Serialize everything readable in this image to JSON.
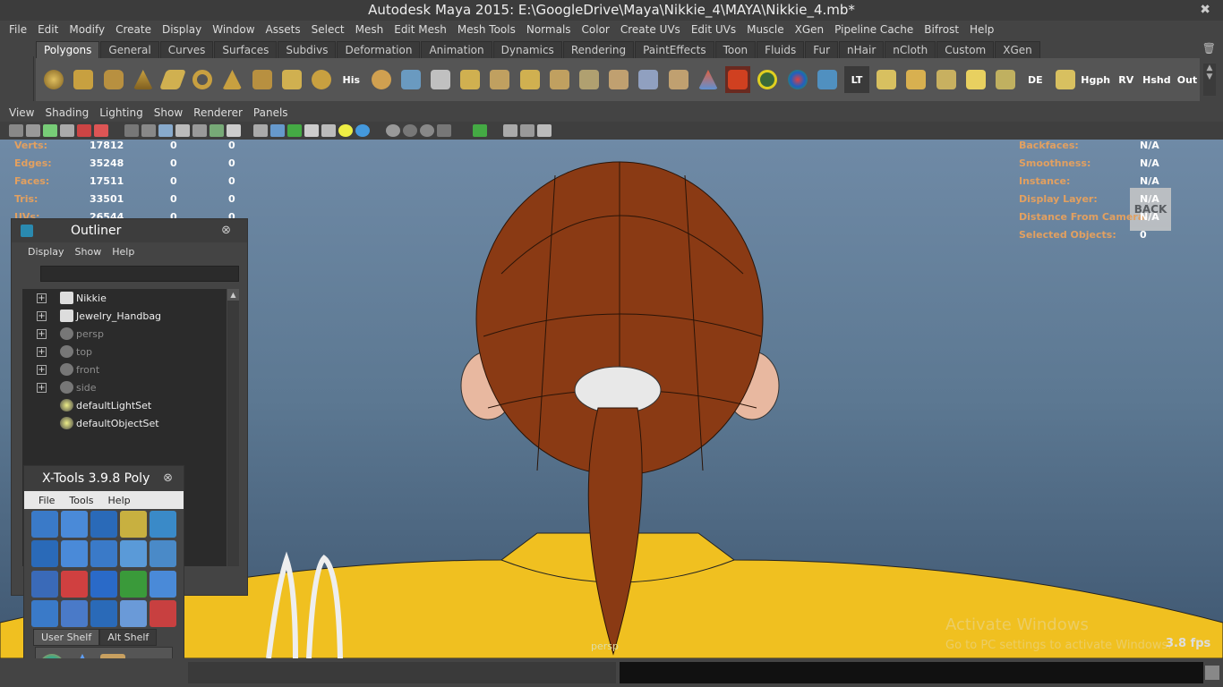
{
  "window": {
    "title": "Autodesk Maya 2015: E:\\GoogleDrive\\Maya\\Nikkie_4\\MAYA\\Nikkie_4.mb*",
    "close_glyph": "✖"
  },
  "menubar": [
    "File",
    "Edit",
    "Modify",
    "Create",
    "Display",
    "Window",
    "Assets",
    "Select",
    "Mesh",
    "Edit Mesh",
    "Mesh Tools",
    "Normals",
    "Color",
    "Create UVs",
    "Edit UVs",
    "Muscle",
    "XGen",
    "Pipeline Cache",
    "Bifrost",
    "Help"
  ],
  "shelf": {
    "tabs": [
      "Polygons",
      "General",
      "Curves",
      "Surfaces",
      "Subdivs",
      "Deformation",
      "Animation",
      "Dynamics",
      "Rendering",
      "PaintEffects",
      "Toon",
      "Fluids",
      "Fur",
      "nHair",
      "nCloth",
      "Custom",
      "XGen"
    ],
    "active_tab": "Polygons",
    "labels": {
      "his": "His",
      "lt": "LT",
      "de": "DE",
      "hgph": "Hgph",
      "rv": "RV",
      "hshd": "Hshd",
      "out": "Out"
    }
  },
  "panel_menu": [
    "View",
    "Shading",
    "Lighting",
    "Show",
    "Renderer",
    "Panels"
  ],
  "hud_left": [
    {
      "label": "Verts:",
      "v1": "17812",
      "v2": "0",
      "v3": "0"
    },
    {
      "label": "Edges:",
      "v1": "35248",
      "v2": "0",
      "v3": "0"
    },
    {
      "label": "Faces:",
      "v1": "17511",
      "v2": "0",
      "v3": "0"
    },
    {
      "label": "Tris:",
      "v1": "33501",
      "v2": "0",
      "v3": "0"
    },
    {
      "label": "UVs:",
      "v1": "26544",
      "v2": "0",
      "v3": "0"
    }
  ],
  "hud_right": [
    {
      "label": "Backfaces:",
      "value": "N/A"
    },
    {
      "label": "Smoothness:",
      "value": "N/A"
    },
    {
      "label": "Instance:",
      "value": "N/A"
    },
    {
      "label": "Display Layer:",
      "value": "N/A"
    },
    {
      "label": "Distance From Camera:",
      "value": "N/A"
    },
    {
      "label": "Selected Objects:",
      "value": "0"
    }
  ],
  "viewcube": "BACK",
  "camera_name": "persp",
  "fps": "3.8 fps",
  "watermark": {
    "line1": "Activate Windows",
    "line2": "Go to PC settings to activate Windows."
  },
  "outliner": {
    "title": "Outliner",
    "menu": [
      "Display",
      "Show",
      "Help"
    ],
    "items": [
      {
        "label": "Nikkie",
        "expand": "+",
        "dim": false
      },
      {
        "label": "Jewelry_Handbag",
        "expand": "+",
        "dim": false
      },
      {
        "label": "persp",
        "expand": "+",
        "dim": true
      },
      {
        "label": "top",
        "expand": "+",
        "dim": true
      },
      {
        "label": "front",
        "expand": "+",
        "dim": true
      },
      {
        "label": "side",
        "expand": "+",
        "dim": true
      },
      {
        "label": "defaultLightSet",
        "expand": "",
        "dim": false
      },
      {
        "label": "defaultObjectSet",
        "expand": "",
        "dim": false
      }
    ]
  },
  "xtools": {
    "title": "X-Tools 3.9.8 Poly",
    "menu": [
      "File",
      "Tools",
      "Help"
    ],
    "tabs": [
      "User Shelf",
      "Alt Shelf"
    ]
  },
  "colors": {
    "hud_label": "#e2a060",
    "hair": "#8a3a14",
    "shirt": "#f0c020"
  }
}
